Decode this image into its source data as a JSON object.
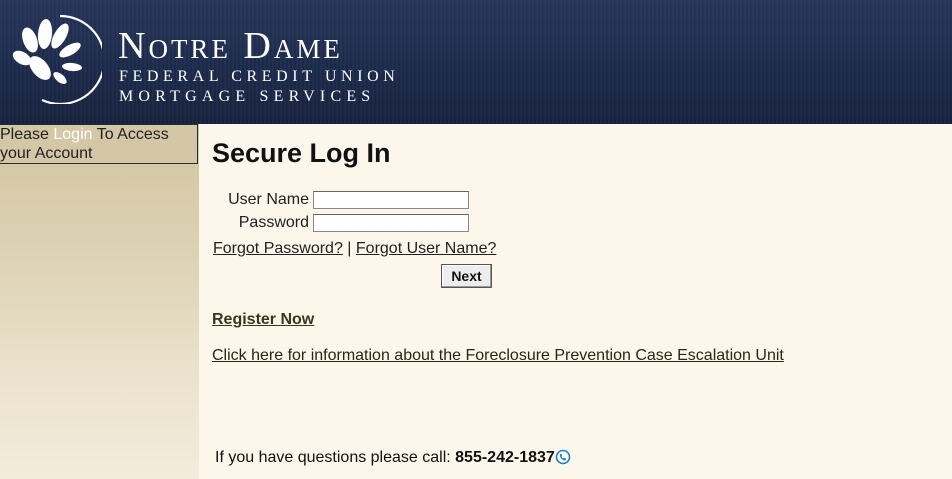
{
  "header": {
    "brand_name": "Notre Dame",
    "brand_line1": "FEDERAL CREDIT UNION",
    "brand_line2": "MORTGAGE SERVICES",
    "bg_color": "#1f2d4f"
  },
  "sidebar": {
    "prefix": "Please ",
    "login_link": "Login",
    "suffix": " To Access your Account"
  },
  "login": {
    "title": "Secure Log In",
    "username_label": "User Name",
    "username_value": "",
    "password_label": "Password",
    "password_value": "",
    "forgot_password": "Forgot Password?",
    "separator": " | ",
    "forgot_username": "Forgot User Name?",
    "next_label": "Next"
  },
  "links": {
    "register": "Register Now",
    "foreclosure": "Click here for information about the Foreclosure Prevention Case Escalation Unit"
  },
  "contact": {
    "text": "If you have questions please call: ",
    "phone": "855-242-1837",
    "icon": "phone-call-icon"
  }
}
